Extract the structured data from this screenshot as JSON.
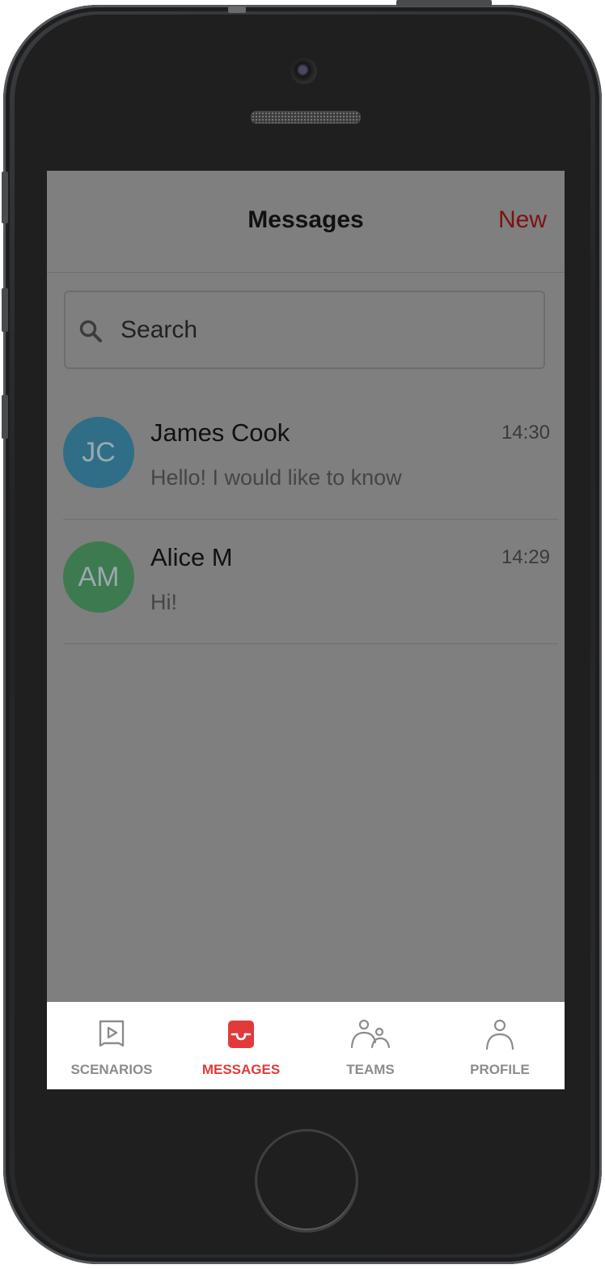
{
  "header": {
    "title": "Messages",
    "new_label": "New"
  },
  "search": {
    "placeholder": "Search"
  },
  "conversations": [
    {
      "initials": "JC",
      "name": "James Cook",
      "time": "14:30",
      "preview": "Hello! I would like to know",
      "avatar_color": "#2f6e86"
    },
    {
      "initials": "AM",
      "name": "Alice M",
      "time": "14:29",
      "preview": "Hi!",
      "avatar_color": "#3e7a4f"
    }
  ],
  "tabbar": {
    "tabs": [
      {
        "label": "SCENARIOS",
        "icon": "scenarios-icon",
        "active": false
      },
      {
        "label": "MESSAGES",
        "icon": "messages-icon",
        "active": true
      },
      {
        "label": "TEAMS",
        "icon": "teams-icon",
        "active": false
      },
      {
        "label": "PROFILE",
        "icon": "profile-icon",
        "active": false
      }
    ]
  },
  "colors": {
    "accent": "#e23a3a",
    "new_link": "#7c1212",
    "overlay": "#7f7f7f"
  }
}
